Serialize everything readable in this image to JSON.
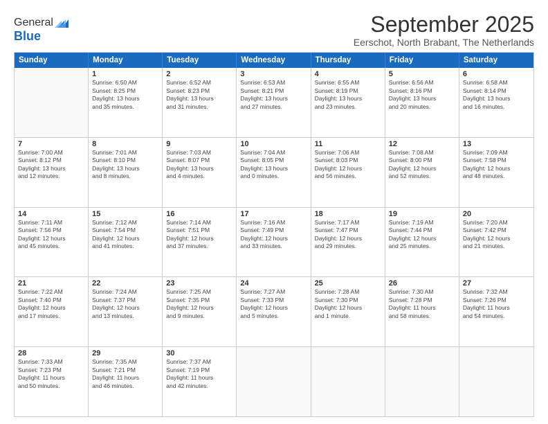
{
  "logo": {
    "general": "General",
    "blue": "Blue"
  },
  "header": {
    "month": "September 2025",
    "location": "Eerschot, North Brabant, The Netherlands"
  },
  "weekdays": [
    "Sunday",
    "Monday",
    "Tuesday",
    "Wednesday",
    "Thursday",
    "Friday",
    "Saturday"
  ],
  "rows": [
    [
      {
        "day": "",
        "info": ""
      },
      {
        "day": "1",
        "info": "Sunrise: 6:50 AM\nSunset: 8:25 PM\nDaylight: 13 hours\nand 35 minutes."
      },
      {
        "day": "2",
        "info": "Sunrise: 6:52 AM\nSunset: 8:23 PM\nDaylight: 13 hours\nand 31 minutes."
      },
      {
        "day": "3",
        "info": "Sunrise: 6:53 AM\nSunset: 8:21 PM\nDaylight: 13 hours\nand 27 minutes."
      },
      {
        "day": "4",
        "info": "Sunrise: 6:55 AM\nSunset: 8:19 PM\nDaylight: 13 hours\nand 23 minutes."
      },
      {
        "day": "5",
        "info": "Sunrise: 6:56 AM\nSunset: 8:16 PM\nDaylight: 13 hours\nand 20 minutes."
      },
      {
        "day": "6",
        "info": "Sunrise: 6:58 AM\nSunset: 8:14 PM\nDaylight: 13 hours\nand 16 minutes."
      }
    ],
    [
      {
        "day": "7",
        "info": "Sunrise: 7:00 AM\nSunset: 8:12 PM\nDaylight: 13 hours\nand 12 minutes."
      },
      {
        "day": "8",
        "info": "Sunrise: 7:01 AM\nSunset: 8:10 PM\nDaylight: 13 hours\nand 8 minutes."
      },
      {
        "day": "9",
        "info": "Sunrise: 7:03 AM\nSunset: 8:07 PM\nDaylight: 13 hours\nand 4 minutes."
      },
      {
        "day": "10",
        "info": "Sunrise: 7:04 AM\nSunset: 8:05 PM\nDaylight: 13 hours\nand 0 minutes."
      },
      {
        "day": "11",
        "info": "Sunrise: 7:06 AM\nSunset: 8:03 PM\nDaylight: 12 hours\nand 56 minutes."
      },
      {
        "day": "12",
        "info": "Sunrise: 7:08 AM\nSunset: 8:00 PM\nDaylight: 12 hours\nand 52 minutes."
      },
      {
        "day": "13",
        "info": "Sunrise: 7:09 AM\nSunset: 7:58 PM\nDaylight: 12 hours\nand 48 minutes."
      }
    ],
    [
      {
        "day": "14",
        "info": "Sunrise: 7:11 AM\nSunset: 7:56 PM\nDaylight: 12 hours\nand 45 minutes."
      },
      {
        "day": "15",
        "info": "Sunrise: 7:12 AM\nSunset: 7:54 PM\nDaylight: 12 hours\nand 41 minutes."
      },
      {
        "day": "16",
        "info": "Sunrise: 7:14 AM\nSunset: 7:51 PM\nDaylight: 12 hours\nand 37 minutes."
      },
      {
        "day": "17",
        "info": "Sunrise: 7:16 AM\nSunset: 7:49 PM\nDaylight: 12 hours\nand 33 minutes."
      },
      {
        "day": "18",
        "info": "Sunrise: 7:17 AM\nSunset: 7:47 PM\nDaylight: 12 hours\nand 29 minutes."
      },
      {
        "day": "19",
        "info": "Sunrise: 7:19 AM\nSunset: 7:44 PM\nDaylight: 12 hours\nand 25 minutes."
      },
      {
        "day": "20",
        "info": "Sunrise: 7:20 AM\nSunset: 7:42 PM\nDaylight: 12 hours\nand 21 minutes."
      }
    ],
    [
      {
        "day": "21",
        "info": "Sunrise: 7:22 AM\nSunset: 7:40 PM\nDaylight: 12 hours\nand 17 minutes."
      },
      {
        "day": "22",
        "info": "Sunrise: 7:24 AM\nSunset: 7:37 PM\nDaylight: 12 hours\nand 13 minutes."
      },
      {
        "day": "23",
        "info": "Sunrise: 7:25 AM\nSunset: 7:35 PM\nDaylight: 12 hours\nand 9 minutes."
      },
      {
        "day": "24",
        "info": "Sunrise: 7:27 AM\nSunset: 7:33 PM\nDaylight: 12 hours\nand 5 minutes."
      },
      {
        "day": "25",
        "info": "Sunrise: 7:28 AM\nSunset: 7:30 PM\nDaylight: 12 hours\nand 1 minute."
      },
      {
        "day": "26",
        "info": "Sunrise: 7:30 AM\nSunset: 7:28 PM\nDaylight: 11 hours\nand 58 minutes."
      },
      {
        "day": "27",
        "info": "Sunrise: 7:32 AM\nSunset: 7:26 PM\nDaylight: 11 hours\nand 54 minutes."
      }
    ],
    [
      {
        "day": "28",
        "info": "Sunrise: 7:33 AM\nSunset: 7:23 PM\nDaylight: 11 hours\nand 50 minutes."
      },
      {
        "day": "29",
        "info": "Sunrise: 7:35 AM\nSunset: 7:21 PM\nDaylight: 11 hours\nand 46 minutes."
      },
      {
        "day": "30",
        "info": "Sunrise: 7:37 AM\nSunset: 7:19 PM\nDaylight: 11 hours\nand 42 minutes."
      },
      {
        "day": "",
        "info": ""
      },
      {
        "day": "",
        "info": ""
      },
      {
        "day": "",
        "info": ""
      },
      {
        "day": "",
        "info": ""
      }
    ]
  ]
}
